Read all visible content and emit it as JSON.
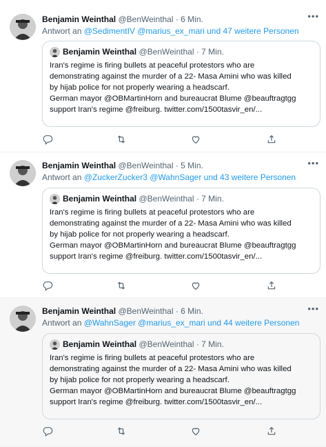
{
  "tweets": [
    {
      "name": "Benjamin Weinthal",
      "handle": "@BenWeinthal",
      "time": "· 6 Min.",
      "reply_prefix": "Antwort an ",
      "reply_to": "@SedimentIV @marius_ex_mari und 47 weitere Personen",
      "quote": {
        "name": "Benjamin Weinthal",
        "handle": "@BenWeinthal",
        "time": "· 7 Min.",
        "lines": [
          "Iran's regime is firing bullets at peaceful protestors who are",
          "demonstrating against the murder of a 22- Masa Amini who was killed",
          "by hijab police for not properly wearing a headscarf.",
          "German mayor @OBMartinHorn and bureaucrat Blume @beauftragtgg",
          "support Iran's regime @freiburg. twitter.com/1500tasvir_en/..."
        ]
      }
    },
    {
      "name": "Benjamin Weinthal",
      "handle": "@BenWeinthal",
      "time": "· 5 Min.",
      "reply_prefix": "Antwort an ",
      "reply_to": "@ZuckerZucker3 @WahnSager und 43 weitere Personen",
      "quote": {
        "name": "Benjamin Weinthal",
        "handle": "@BenWeinthal",
        "time": "· 7 Min.",
        "lines": [
          "Iran's regime is firing bullets at peaceful protestors who are",
          "demonstrating against the murder of a 22- Masa Amini who was killed",
          "by hijab police for not properly wearing a headscarf.",
          "German mayor @OBMartinHorn and bureaucrat Blume @beauftragtgg",
          "support Iran's regime @freiburg. twitter.com/1500tasvir_en/..."
        ]
      }
    },
    {
      "name": "Benjamin Weinthal",
      "handle": "@BenWeinthal",
      "time": "· 6 Min.",
      "reply_prefix": "Antwort an ",
      "reply_to": "@WahnSager @marius_ex_mari und 44 weitere Personen",
      "quote": {
        "name": "Benjamin Weinthal",
        "handle": "@BenWeinthal",
        "time": "· 7 Min.",
        "lines": [
          "Iran's regime is firing bullets at peaceful protestors who are",
          "demonstrating against the murder of a 22- Masa Amini who was killed",
          "by hijab police for not properly wearing a headscarf.",
          "German mayor @OBMartinHorn and bureaucrat Blume @beauftragtgg",
          "support Iran's regime @freiburg. twitter.com/1500tasvir_en/..."
        ]
      }
    }
  ],
  "colors": {
    "link": "#1d9bf0",
    "muted": "#536471",
    "border": "#cfd9de",
    "highlight_bg": "#f7f7f7"
  },
  "icons": {
    "more": "more-icon",
    "reply": "reply-icon",
    "retweet": "retweet-icon",
    "like": "like-icon",
    "share": "share-icon"
  }
}
